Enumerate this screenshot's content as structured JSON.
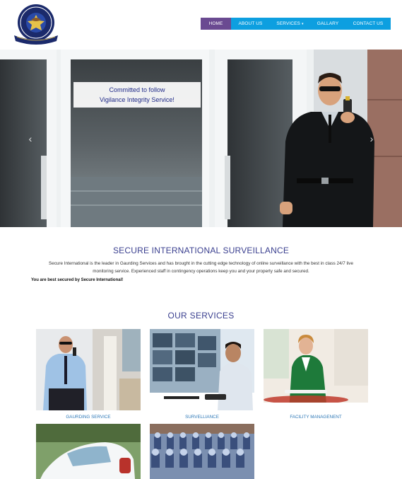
{
  "header": {
    "logo_text_top": "SECURE INTERNATIONAL",
    "logo_text_bottom": "SURVEILLANCE",
    "logo_motto": "Vigilance - Integrity - Service",
    "nav": [
      {
        "label": "HOME",
        "active": true
      },
      {
        "label": "ABOUT US",
        "active": false
      },
      {
        "label": "SERVICES",
        "active": false,
        "has_dropdown": true
      },
      {
        "label": "GALLARY",
        "active": false
      },
      {
        "label": "CONTACT US",
        "active": false
      }
    ],
    "colors": {
      "nav_bg": "#0d9fe0",
      "nav_active": "#6a4a91"
    }
  },
  "hero": {
    "banner_line1": "Committed to follow",
    "banner_line2": "Vigilance Integrity Service!",
    "prev_icon": "chevron-left-icon",
    "next_icon": "chevron-right-icon"
  },
  "intro": {
    "title": "SECURE INTERNATIONAL SURVEILLANCE",
    "text_line1": "Secure International is the leader in Gaurding Services and has brought in the cutting edge technology of online surveillance with the best in class 24/7 live",
    "text_line2": "monitoring service. Experienced staff in contingency operations keep you and your property safe and secured.",
    "bold": "You are best secured by Secure International!"
  },
  "services": {
    "title": "OUR SERVICES",
    "items": [
      {
        "label": "GAURDING SERVICE"
      },
      {
        "label": "SURVELLIANCE"
      },
      {
        "label": "FACILITY MANAGENENT"
      },
      {
        "label": ""
      },
      {
        "label": ""
      }
    ]
  }
}
